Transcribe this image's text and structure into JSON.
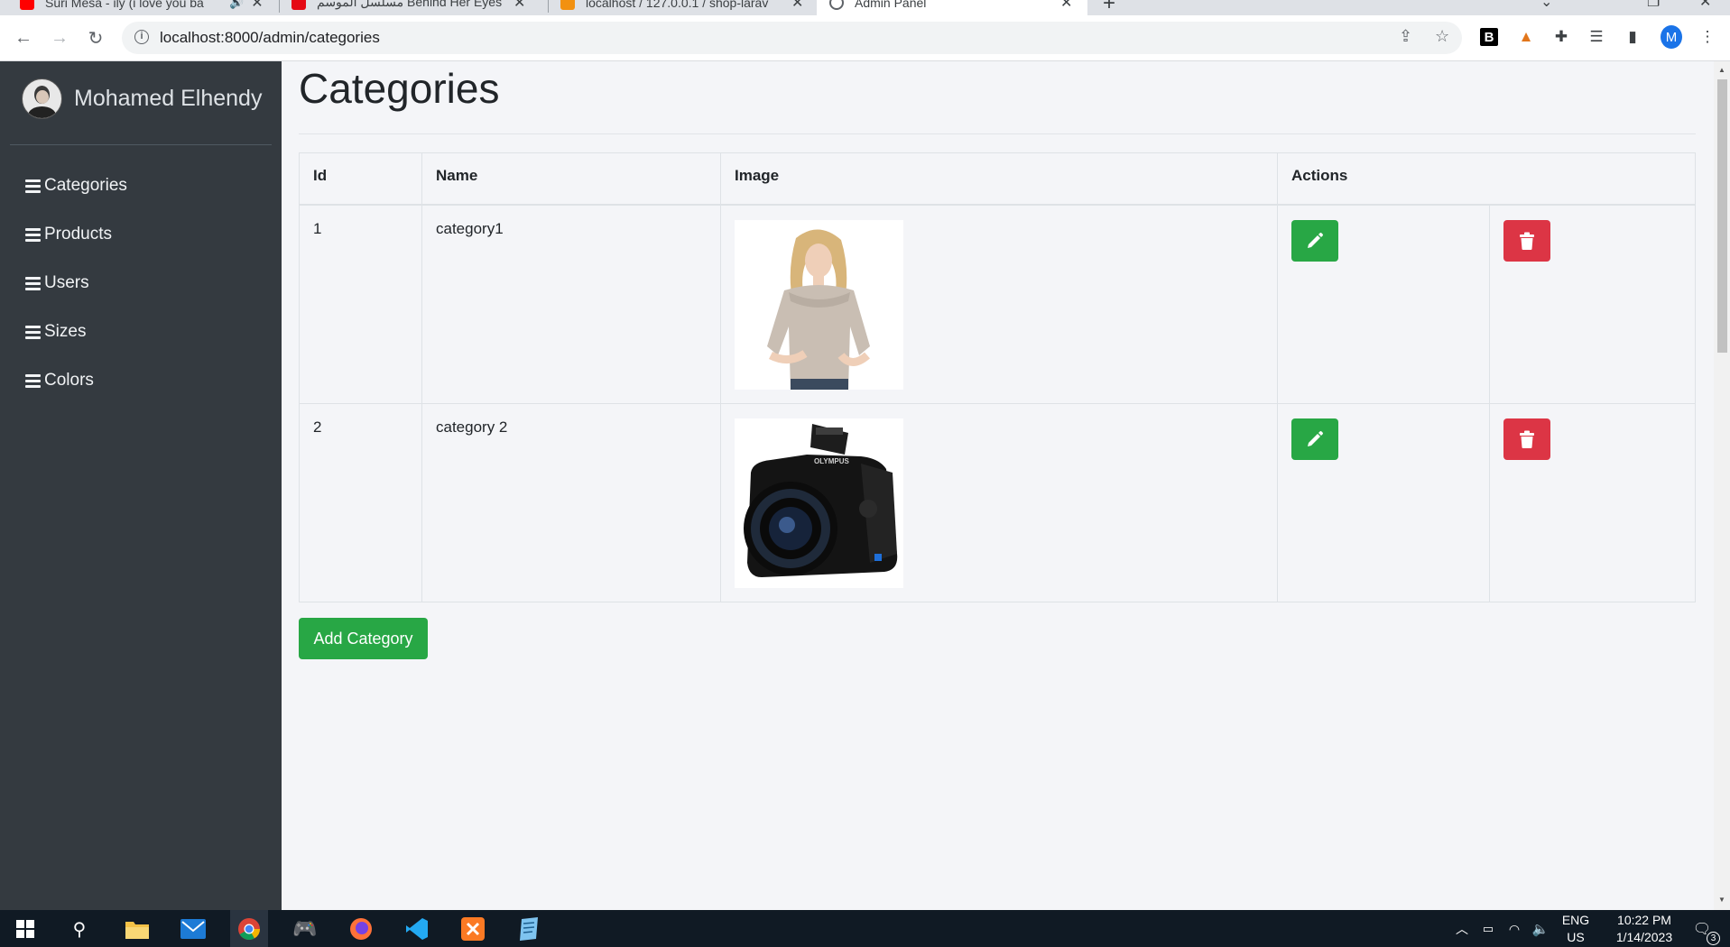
{
  "browser": {
    "tabs": [
      {
        "title": "Suri Mesa - ily (i love you ba",
        "favicon_color": "#ff0000"
      },
      {
        "title": "مسلسل الموسم Behind Her Eyes",
        "favicon_color": "#e50914"
      },
      {
        "title": "localhost / 127.0.0.1 / shop-larav",
        "favicon_color": "#f29111"
      },
      {
        "title": "Admin Panel",
        "favicon_color": "#5f6368"
      }
    ],
    "url": "localhost:8000/admin/categories",
    "profile_initial": "M"
  },
  "sidebar": {
    "user_name": "Mohamed Elhendy",
    "items": [
      {
        "label": "Categories"
      },
      {
        "label": "Products"
      },
      {
        "label": "Users"
      },
      {
        "label": "Sizes"
      },
      {
        "label": "Colors"
      }
    ]
  },
  "page": {
    "title": "Categories",
    "columns": [
      "Id",
      "Name",
      "Image",
      "Actions"
    ],
    "rows": [
      {
        "id": "1",
        "name": "category1",
        "image": "woman-sweater-photo"
      },
      {
        "id": "2",
        "name": "category 2",
        "image": "camera-photo"
      }
    ],
    "add_button": "Add Category"
  },
  "colors": {
    "sidebar_bg": "#343a40",
    "success": "#28a745",
    "danger": "#dc3545"
  },
  "taskbar": {
    "lang": "ENG",
    "region": "US",
    "time": "10:22 PM",
    "date": "1/14/2023",
    "notifications": "3"
  }
}
